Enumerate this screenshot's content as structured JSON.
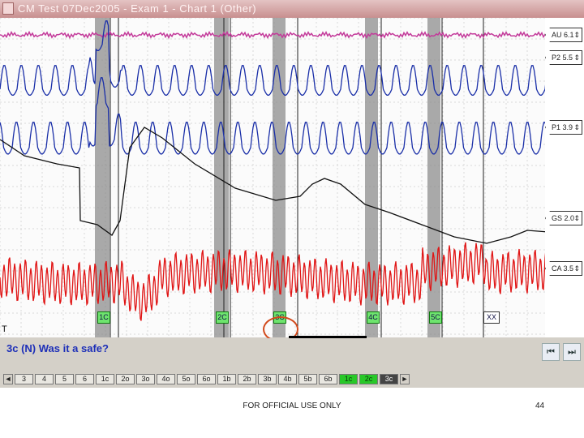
{
  "window": {
    "title": "CM Test 07Dec2005 - Exam 1 - Chart 1 (Other)"
  },
  "channels": [
    {
      "label": "AU 6.1",
      "arrow": "⇕"
    },
    {
      "label": "P2 5.5",
      "arrow": "⇕"
    },
    {
      "label": "P1 3.9",
      "arrow": "⇕"
    },
    {
      "label": "GS 2.0",
      "arrow": "⇕"
    },
    {
      "label": "CA 3.5",
      "arrow": "⇕"
    }
  ],
  "question_markers": [
    {
      "label": "1C"
    },
    {
      "label": "2C"
    },
    {
      "label": "3C"
    },
    {
      "label": "4C"
    },
    {
      "label": "5C"
    },
    {
      "label": "XX"
    }
  ],
  "start_marker": "T",
  "question": {
    "text": "3c (N) Was it a safe?"
  },
  "nav": {
    "first": "⏮",
    "next": "⏭"
  },
  "tabs": [
    {
      "label": "◄",
      "style": "arrow"
    },
    {
      "label": "3",
      "style": ""
    },
    {
      "label": "4",
      "style": ""
    },
    {
      "label": "5",
      "style": ""
    },
    {
      "label": "6",
      "style": ""
    },
    {
      "label": "1c",
      "style": ""
    },
    {
      "label": "2o",
      "style": ""
    },
    {
      "label": "3o",
      "style": ""
    },
    {
      "label": "4o",
      "style": ""
    },
    {
      "label": "5o",
      "style": ""
    },
    {
      "label": "6o",
      "style": ""
    },
    {
      "label": "1b",
      "style": ""
    },
    {
      "label": "2b",
      "style": ""
    },
    {
      "label": "3b",
      "style": ""
    },
    {
      "label": "4b",
      "style": ""
    },
    {
      "label": "5b",
      "style": ""
    },
    {
      "label": "6b",
      "style": ""
    },
    {
      "label": "1c",
      "style": "green"
    },
    {
      "label": "2c",
      "style": "green"
    },
    {
      "label": "3c",
      "style": "dark"
    },
    {
      "label": "►",
      "style": "arrow"
    }
  ],
  "footer": {
    "classification": "FOR OFFICIAL USE ONLY",
    "page": "44"
  },
  "colors": {
    "pneumo": "#1a2fa8",
    "gsr": "#111111",
    "cardio": "#e01414",
    "au": "#c33a9a",
    "question_bar": "#8e8e8e",
    "highlight_circle": "#d24a1c"
  }
}
